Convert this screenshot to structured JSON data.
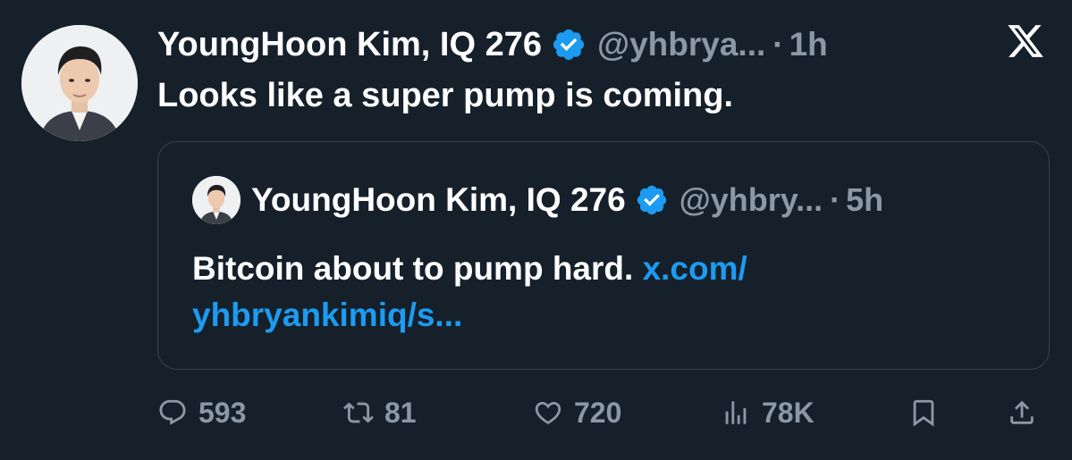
{
  "post": {
    "author_name": "YoungHoon Kim, IQ 276",
    "handle": "@yhbrya...",
    "separator": "·",
    "time": "1h",
    "text": "Looks like a super pump is coming.",
    "verified_icon": "verified-badge-icon",
    "brand_icon": "x-logo-icon"
  },
  "quoted": {
    "author_name": "YoungHoon Kim, IQ 276",
    "handle": "@yhbry...",
    "separator": "·",
    "time": "5h",
    "text": "Bitcoin about to pump hard. ",
    "link": "x.com/ yhbryankimiq/s..."
  },
  "actions": {
    "replies": "593",
    "reposts": "81",
    "likes": "720",
    "views": "78K"
  },
  "colors": {
    "background": "#15202b",
    "muted": "#8b98a5",
    "accent": "#1d9bf0",
    "border": "#38444d"
  }
}
